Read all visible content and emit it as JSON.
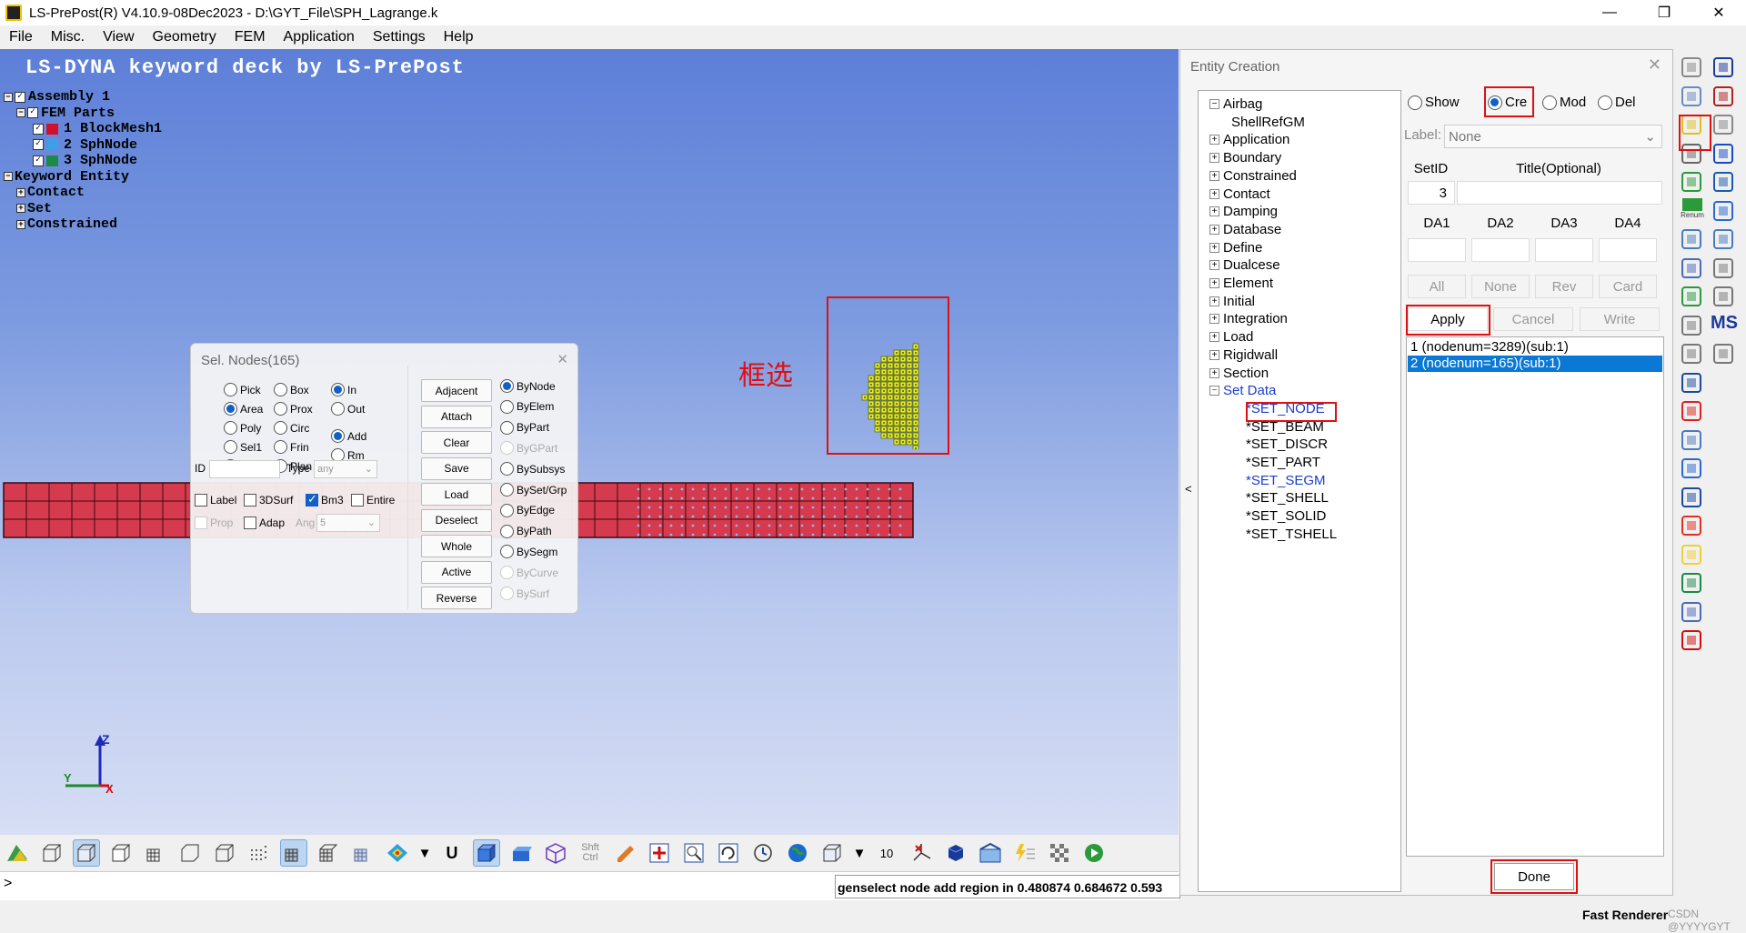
{
  "window": {
    "title": "LS-PrePost(R) V4.10.9-08Dec2023 - D:\\GYT_File\\SPH_Lagrange.k",
    "controls": [
      "—",
      "❐",
      "✕"
    ]
  },
  "menu": [
    "File",
    "Misc.",
    "View",
    "Geometry",
    "FEM",
    "Application",
    "Settings",
    "Help"
  ],
  "viewport": {
    "title": "LS-DYNA keyword deck by LS-PrePost",
    "tree": {
      "assembly": "Assembly 1",
      "fem_parts": "FEM Parts",
      "parts": [
        {
          "label": "1 BlockMesh1",
          "color": "#d2102e"
        },
        {
          "label": "2 SphNode",
          "color": "#3aa0e8"
        },
        {
          "label": "3 SphNode",
          "color": "#1e8a4a"
        }
      ],
      "keyword_entity": "Keyword Entity",
      "entities": [
        "Contact",
        "Set",
        "Constrained"
      ]
    },
    "selection_note": "框选",
    "triad": {
      "z": "Z",
      "y": "Y",
      "x": "X"
    },
    "colors": {
      "mesh": "#d63a4e",
      "sph": "#e8ec2a"
    }
  },
  "sel_nodes": {
    "title": "Sel. Nodes(165)",
    "close": "✕",
    "pick_modes": [
      {
        "label": "Pick",
        "on": false
      },
      {
        "label": "Area",
        "on": true
      },
      {
        "label": "Poly",
        "on": false
      },
      {
        "label": "Sel1",
        "on": false
      },
      {
        "label": "Sphe",
        "on": false
      }
    ],
    "shape_modes": [
      {
        "label": "Box",
        "on": false
      },
      {
        "label": "Prox",
        "on": false
      },
      {
        "label": "Circ",
        "on": false
      },
      {
        "label": "Frin",
        "on": false
      },
      {
        "label": "Plan",
        "on": false
      }
    ],
    "inout": [
      {
        "label": "In",
        "on": true
      },
      {
        "label": "Out",
        "on": false
      }
    ],
    "addrm": [
      {
        "label": "Add",
        "on": true
      },
      {
        "label": "Rm",
        "on": false
      }
    ],
    "buttons": [
      "Adjacent",
      "Attach",
      "Clear",
      "Save",
      "Load",
      "Deselect",
      "Whole",
      "Active",
      "Reverse"
    ],
    "by": [
      {
        "label": "ByNode",
        "on": true,
        "disabled": false
      },
      {
        "label": "ByElem",
        "on": false,
        "disabled": false
      },
      {
        "label": "ByPart",
        "on": false,
        "disabled": false
      },
      {
        "label": "ByGPart",
        "on": false,
        "disabled": true
      },
      {
        "label": "BySubsys",
        "on": false,
        "disabled": false
      },
      {
        "label": "BySet/Grp",
        "on": false,
        "disabled": false
      },
      {
        "label": "ByEdge",
        "on": false,
        "disabled": false
      },
      {
        "label": "ByPath",
        "on": false,
        "disabled": false
      },
      {
        "label": "BySegm",
        "on": false,
        "disabled": false
      },
      {
        "label": "ByCurve",
        "on": false,
        "disabled": true
      },
      {
        "label": "BySurf",
        "on": false,
        "disabled": true
      }
    ],
    "id_label": "ID",
    "id_value": "",
    "type_label": "Type",
    "type_value": "any",
    "checks": [
      {
        "label": "Label",
        "on": false
      },
      {
        "label": "3DSurf",
        "on": false
      },
      {
        "label": "Bm3",
        "on": true
      },
      {
        "label": "Entire",
        "on": false
      }
    ],
    "prop_label": "Prop",
    "adap_label": "Adap",
    "ang_label": "Ang",
    "ang_value": "5"
  },
  "bottom_toolbar": {
    "shft": "Shft",
    "ctrl": "Ctrl",
    "ten": "10",
    "u_label": "U"
  },
  "command": {
    "prompt": ">",
    "status": "genselect node add region in 0.480874 0.684672 0.593"
  },
  "statusbar": {
    "renderer": "Fast Renderer",
    "watermark": "CSDN @YYYYGYT"
  },
  "entity": {
    "title": "Entity Creation",
    "close": "✕",
    "collapse": "<",
    "tree": [
      {
        "label": "Airbag",
        "exp": "−"
      },
      {
        "label": "ShellRefGM",
        "child": true
      },
      {
        "label": "Application",
        "exp": "+"
      },
      {
        "label": "Boundary",
        "exp": "+"
      },
      {
        "label": "Constrained",
        "exp": "+"
      },
      {
        "label": "Contact",
        "exp": "+"
      },
      {
        "label": "Damping",
        "exp": "+"
      },
      {
        "label": "Database",
        "exp": "+"
      },
      {
        "label": "Define",
        "exp": "+"
      },
      {
        "label": "Dualcese",
        "exp": "+"
      },
      {
        "label": "Element",
        "exp": "+"
      },
      {
        "label": "Initial",
        "exp": "+"
      },
      {
        "label": "Integration",
        "exp": "+"
      },
      {
        "label": "Load",
        "exp": "+"
      },
      {
        "label": "Rigidwall",
        "exp": "+"
      },
      {
        "label": "Section",
        "exp": "+"
      },
      {
        "label": "Set Data",
        "exp": "−",
        "blue": true
      },
      {
        "label": "*SET_NODE",
        "child": true,
        "blue": true
      },
      {
        "label": "*SET_BEAM",
        "child": true
      },
      {
        "label": "*SET_DISCR",
        "child": true
      },
      {
        "label": "*SET_PART",
        "child": true
      },
      {
        "label": "*SET_SEGM",
        "child": true,
        "blue": true
      },
      {
        "label": "*SET_SHELL",
        "child": true
      },
      {
        "label": "*SET_SOLID",
        "child": true
      },
      {
        "label": "*SET_TSHELL",
        "child": true
      }
    ],
    "modes": [
      {
        "label": "Show",
        "on": false
      },
      {
        "label": "Cre",
        "on": true
      },
      {
        "label": "Mod",
        "on": false
      },
      {
        "label": "Del",
        "on": false
      }
    ],
    "label_caption": "Label:",
    "label_value": "None",
    "setid_header": "SetID",
    "title_header": "Title(Optional)",
    "setid_value": "3",
    "da_headers": [
      "DA1",
      "DA2",
      "DA3",
      "DA4"
    ],
    "row_buttons": [
      "All",
      "None",
      "Rev",
      "Card"
    ],
    "action_buttons": [
      "Apply",
      "Cancel",
      "Write"
    ],
    "list": [
      {
        "text": "1 (nodenum=3289)(sub:1)",
        "sel": false
      },
      {
        "text": "2 (nodenum=165)(sub:1)",
        "sel": true
      }
    ],
    "done": "Done"
  },
  "side_toolbar": {
    "renum": "Renum",
    "ms": "MS"
  }
}
